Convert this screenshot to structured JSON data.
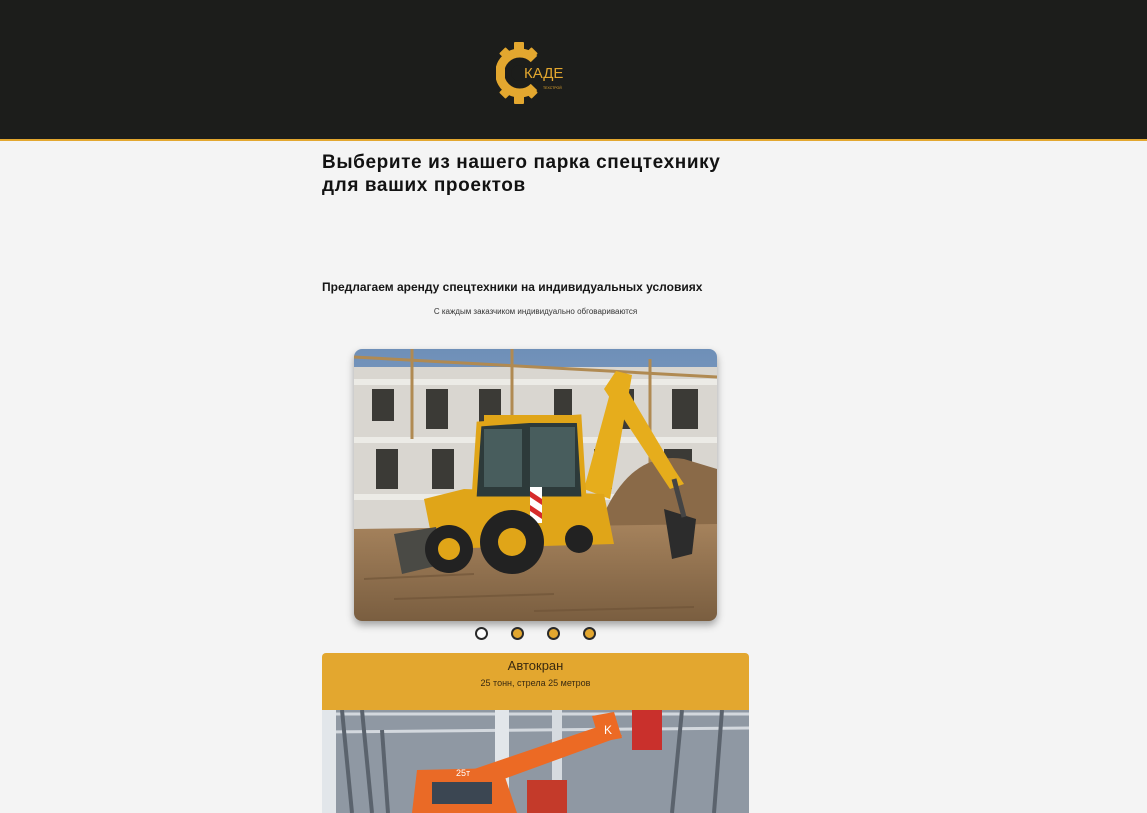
{
  "header": {
    "logo_text": "КАДЕ",
    "logo_subtext": "ТЕХСТРОЙ"
  },
  "main": {
    "title_line1": "Выберите из нашего парка спецтехнику",
    "title_line2": "для ваших проектов",
    "offer_title": "Предлагаем аренду спецтехники на индивидуальных условиях",
    "offer_subtitle": "С каждым заказчиком индивидуально обговариваются"
  },
  "slider": {
    "slide_count": 4,
    "active_index": 0
  },
  "card": {
    "title": "Автокран",
    "description": "25 тонн, стрела 25 метров",
    "crane_marking": "25т"
  },
  "colors": {
    "header_bg": "#1c1d1b",
    "accent": "#e3a72f",
    "page_bg": "#f4f4f4"
  }
}
